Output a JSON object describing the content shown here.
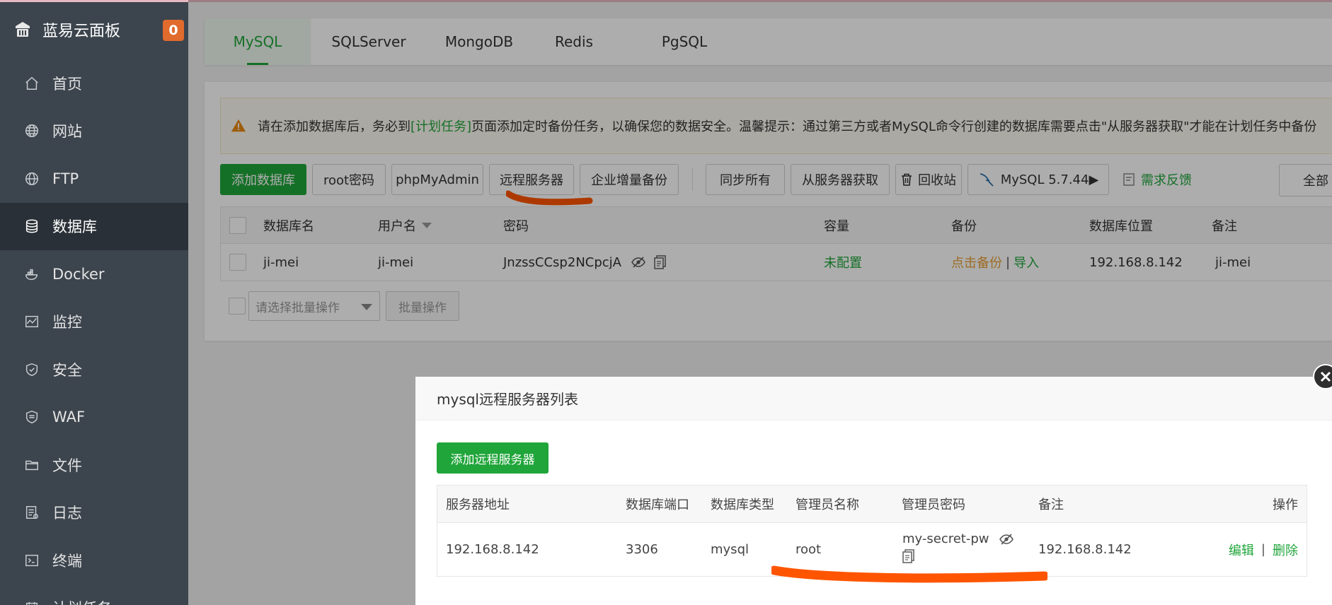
{
  "sidebar": {
    "brand": "蓝易云面板",
    "badge": "0",
    "items": [
      {
        "label": "首页",
        "icon": "home-icon"
      },
      {
        "label": "网站",
        "icon": "globe-icon"
      },
      {
        "label": "FTP",
        "icon": "ftp-globe-icon"
      },
      {
        "label": "数据库",
        "icon": "database-icon",
        "active": true
      },
      {
        "label": "Docker",
        "icon": "docker-icon"
      },
      {
        "label": "监控",
        "icon": "monitor-icon"
      },
      {
        "label": "安全",
        "icon": "shield-icon"
      },
      {
        "label": "WAF",
        "icon": "waf-icon"
      },
      {
        "label": "文件",
        "icon": "folder-icon"
      },
      {
        "label": "日志",
        "icon": "log-icon"
      },
      {
        "label": "终端",
        "icon": "terminal-icon"
      },
      {
        "label": "计划任务",
        "icon": "schedule-icon"
      }
    ]
  },
  "tabs": [
    "MySQL",
    "SQLServer",
    "MongoDB",
    "Redis",
    "PgSQL"
  ],
  "notice": {
    "before": "请在添加数据库后，务必到",
    "link": "[计划任务]",
    "after": "页面添加定时备份任务，以确保您的数据安全。温馨提示：通过第三方或者MySQL命令行创建的数据库需要点击\"从服务器获取\"才能在计划任务中备份"
  },
  "toolbar": {
    "add_db": "添加数据库",
    "root_pw": "root密码",
    "phpmyadmin": "phpMyAdmin",
    "remote_server": "远程服务器",
    "enterprise_backup": "企业增量备份",
    "sync_all": "同步所有",
    "fetch_from_server": "从服务器获取",
    "recycle_bin": "回收站",
    "mysql_version": "MySQL 5.7.44▶",
    "feedback": "需求反馈",
    "filter_all": "全部"
  },
  "db_table": {
    "headers": [
      "数据库名",
      "用户名",
      "密码",
      "容量",
      "备份",
      "数据库位置",
      "备注"
    ],
    "rows": [
      {
        "name": "ji-mei",
        "user": "ji-mei",
        "password": "JnzssCCsp2NCpcjA",
        "capacity": "未配置",
        "backup_action": "点击备份",
        "backup_sep": "|",
        "import": "导入",
        "location": "192.168.8.142",
        "note": "ji-mei"
      }
    ]
  },
  "batch": {
    "select_placeholder": "请选择批量操作",
    "button": "批量操作"
  },
  "modal": {
    "title": "mysql远程服务器列表",
    "add_button": "添加远程服务器",
    "headers": [
      "服务器地址",
      "数据库端口",
      "数据库类型",
      "管理员名称",
      "管理员密码",
      "备注",
      "操作"
    ],
    "rows": [
      {
        "address": "192.168.8.142",
        "port": "3306",
        "type": "mysql",
        "admin": "root",
        "password": "my-secret-pw",
        "note": "192.168.8.142",
        "edit": "编辑",
        "sep": "|",
        "delete": "删除"
      }
    ]
  },
  "colors": {
    "sidebar_bg": "#3c444d",
    "sidebar_active": "#2a3037",
    "accent_green": "#20a53a",
    "badge_orange": "#e16a2d",
    "backup_orange": "#e8a035",
    "annotation_orange": "#ff5500"
  }
}
